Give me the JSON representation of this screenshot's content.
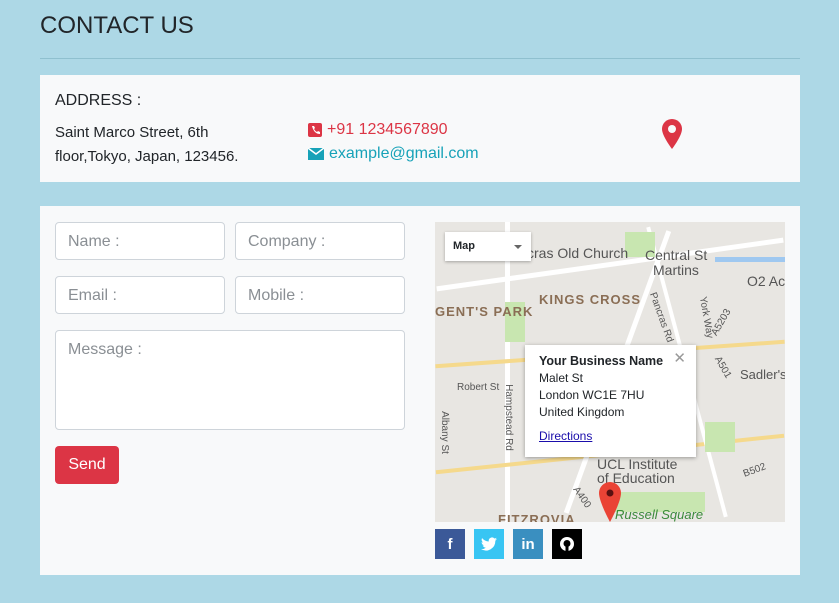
{
  "title": "CONTACT US",
  "address": {
    "label": "ADDRESS :",
    "text": "Saint Marco Street, 6th floor,Tokyo, Japan, 123456.",
    "phone": "+91 1234567890",
    "email": "example@gmail.com"
  },
  "form": {
    "name_placeholder": "Name :",
    "company_placeholder": "Company :",
    "email_placeholder": "Email :",
    "mobile_placeholder": "Mobile :",
    "message_placeholder": "Message :",
    "send_label": "Send"
  },
  "map": {
    "type_selected": "Map",
    "labels": [
      "cras Old Church",
      "Central St",
      "Martins",
      "O2 Ac",
      "KINGS CROSS",
      "GENT'S PARK",
      "Pancras Rd",
      "York Way",
      "A5203",
      "A501",
      "Sadler's",
      "Robert St",
      "Hampstead Rd",
      "Albany St",
      "UCL Institute",
      "of Education",
      "A400",
      "B502",
      "FITZROVIA",
      "Russell Square"
    ],
    "info": {
      "name": "Your Business Name",
      "line1": "Malet St",
      "line2": "London WC1E 7HU",
      "line3": "United Kingdom",
      "directions": "Directions"
    }
  },
  "social": [
    {
      "name": "facebook",
      "label": "f",
      "color": "#3b5998"
    },
    {
      "name": "twitter",
      "label": "t",
      "color": "#38c5f3"
    },
    {
      "name": "linkedin",
      "label": "in",
      "color": "#3a8fc0"
    },
    {
      "name": "github",
      "label": "gh",
      "color": "#000000"
    }
  ],
  "colors": {
    "bg": "#add8e6",
    "danger": "#dc3545",
    "info": "#17a2b8"
  }
}
